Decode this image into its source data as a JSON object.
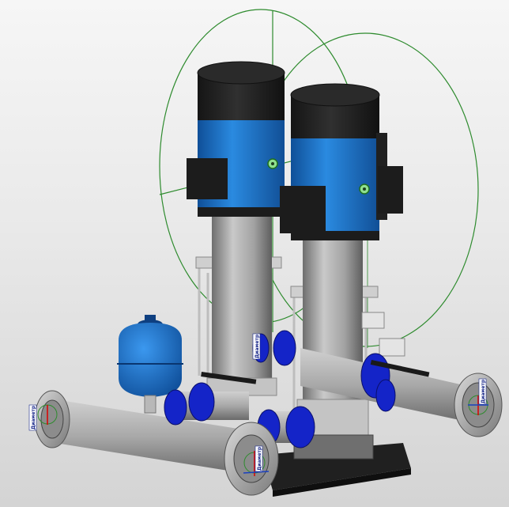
{
  "dimension_tags": [
    {
      "id": "left-flange",
      "label": "Диаметр"
    },
    {
      "id": "center-valve",
      "label": "Диаметр"
    },
    {
      "id": "front-flange",
      "label": "Диаметр"
    },
    {
      "id": "right-flange",
      "label": "Диаметр"
    }
  ],
  "colors": {
    "background_top": "#f6f6f6",
    "background_bottom": "#d4d4d4",
    "motor_blue": "#1e72c8",
    "motor_cap": "#1c1c1c",
    "pipe_grey": "#a9a9a9",
    "valve_blue": "#1424c8",
    "base_dark": "#202020",
    "guide_green": "#2e8b2e",
    "pivot_green": "#2fbf2f"
  },
  "icons": [
    "rotation-pivot-icon",
    "dimension-tag-icon"
  ]
}
